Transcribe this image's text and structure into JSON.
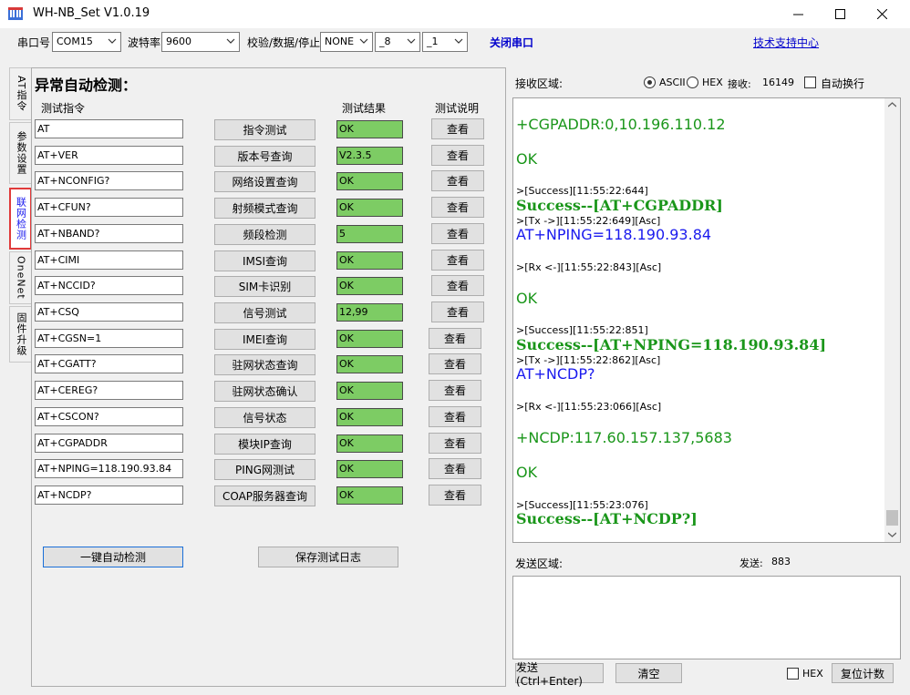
{
  "window": {
    "title": "WH-NB_Set V1.0.19"
  },
  "toolbar": {
    "port_label": "串口号",
    "port_value": "COM15",
    "baud_label": "波特率",
    "baud_value": "9600",
    "parity_label": "校验/数据/停止",
    "parity_value": "NONE",
    "data_bits_value": "_8",
    "stop_bits_value": "_1",
    "close_port": "关闭串口",
    "support_link": "技术支持中心"
  },
  "tabs": [
    "AT指令",
    "参数设置",
    "联网检测",
    "OneNet",
    "固件升级"
  ],
  "panel": {
    "title": "异常自动检测：",
    "col_cmd": "测试指令",
    "col_result": "测试结果",
    "col_desc": "测试说明",
    "view_label": "查看",
    "rows": [
      {
        "cmd": "AT",
        "button": "指令测试",
        "result": "OK"
      },
      {
        "cmd": "AT+VER",
        "button": "版本号查询",
        "result": "V2.3.5"
      },
      {
        "cmd": "AT+NCONFIG?",
        "button": "网络设置查询",
        "result": "OK"
      },
      {
        "cmd": "AT+CFUN?",
        "button": "射频模式查询",
        "result": "OK"
      },
      {
        "cmd": "AT+NBAND?",
        "button": "频段检测",
        "result": "5"
      },
      {
        "cmd": "AT+CIMI",
        "button": "IMSI查询",
        "result": "OK"
      },
      {
        "cmd": "AT+NCCID?",
        "button": "SIM卡识别",
        "result": "OK"
      },
      {
        "cmd": "AT+CSQ",
        "button": "信号测试",
        "result": "12,99"
      },
      {
        "cmd": "AT+CGSN=1",
        "button": "IMEI查询",
        "result": "OK"
      },
      {
        "cmd": "AT+CGATT?",
        "button": "驻网状态查询",
        "result": "OK"
      },
      {
        "cmd": "AT+CEREG?",
        "button": "驻网状态确认",
        "result": "OK"
      },
      {
        "cmd": "AT+CSCON?",
        "button": "信号状态",
        "result": "OK"
      },
      {
        "cmd": "AT+CGPADDR",
        "button": "模块IP查询",
        "result": "OK"
      },
      {
        "cmd": "AT+NPING=118.190.93.84",
        "button": "PING网测试",
        "result": "OK"
      },
      {
        "cmd": "AT+NCDP?",
        "button": "COAP服务器查询",
        "result": "OK"
      }
    ],
    "auto_button": "一键自动检测",
    "save_button": "保存测试日志"
  },
  "receive": {
    "label": "接收区域:",
    "ascii": "ASCII",
    "hex": "HEX",
    "count_label": "接收:",
    "count": "16149",
    "autowrap": "自动换行",
    "lines": [
      "+CGPADDR:0,10.196.110.12",
      "OK",
      ">[Success][11:55:22:644]",
      "Success--[AT+CGPADDR]",
      ">[Tx ->][11:55:22:649][Asc]",
      "AT+NPING=118.190.93.84",
      ">[Rx <-][11:55:22:843][Asc]",
      "OK",
      ">[Success][11:55:22:851]",
      "Success--[AT+NPING=118.190.93.84]",
      ">[Tx ->][11:55:22:862][Asc]",
      "AT+NCDP?",
      ">[Rx <-][11:55:23:066][Asc]",
      "+NCDP:117.60.157.137,5683",
      "OK",
      ">[Success][11:55:23:076]",
      "Success--[AT+NCDP?]"
    ]
  },
  "send": {
    "label": "发送区域:",
    "count_label": "发送:",
    "count": "883",
    "send_button": "发送(Ctrl+Enter)",
    "clear_button": "清空",
    "hex": "HEX",
    "reset_button": "复位计数"
  }
}
